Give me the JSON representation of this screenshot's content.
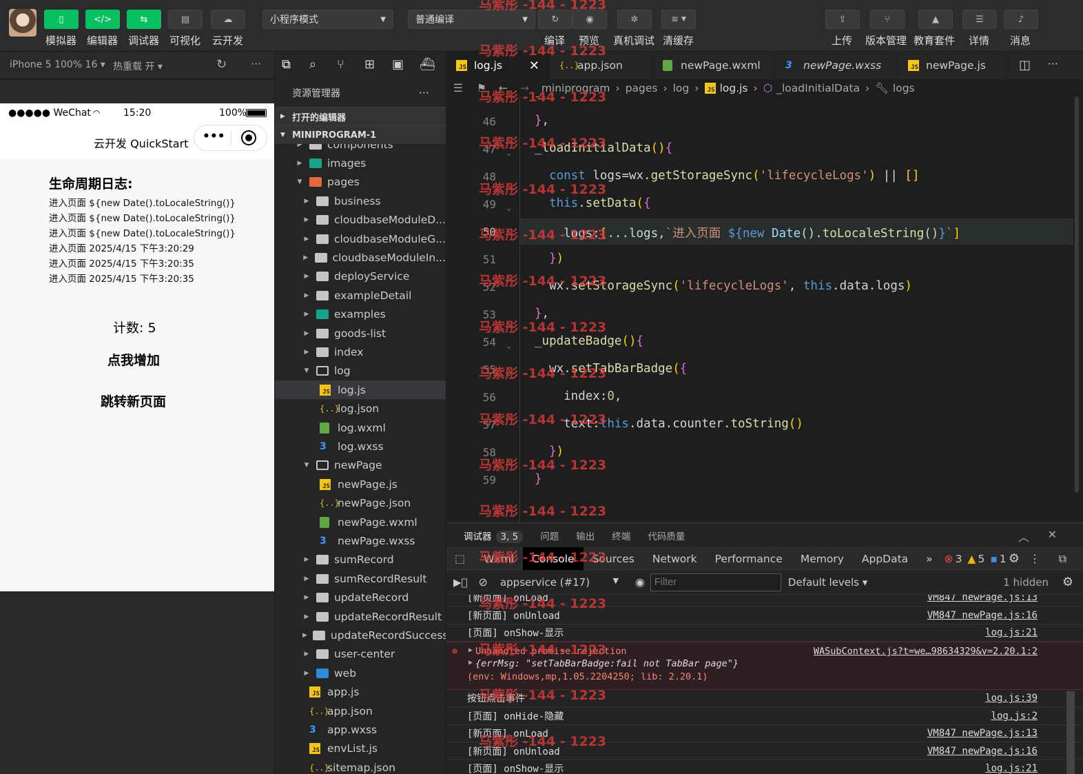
{
  "toolbar": {
    "left_buttons": [
      {
        "label": "模拟器",
        "icon": "phone-icon",
        "glyph": "▯"
      },
      {
        "label": "编辑器",
        "icon": "code-icon",
        "glyph": "</>"
      },
      {
        "label": "调试器",
        "icon": "debug-icon",
        "glyph": "⇆"
      },
      {
        "label": "可视化",
        "icon": "layout-icon",
        "glyph": "▤"
      },
      {
        "label": "云开发",
        "icon": "cloud-icon",
        "glyph": "☁"
      }
    ],
    "mode_select": "小程序模式",
    "compile_select": "普通编译",
    "mid_buttons": [
      {
        "label": "编译",
        "icon": "refresh-icon",
        "glyph": "↻"
      },
      {
        "label": "预览",
        "icon": "eye-icon",
        "glyph": "◉"
      },
      {
        "label": "真机调试",
        "icon": "bug-icon",
        "glyph": "✲"
      },
      {
        "label": "清缓存",
        "icon": "layers-icon",
        "glyph": "≋"
      }
    ],
    "right_buttons": [
      {
        "label": "上传",
        "icon": "upload-icon",
        "glyph": "⇪"
      },
      {
        "label": "版本管理",
        "icon": "branch-icon",
        "glyph": "⑂"
      },
      {
        "label": "教育套件",
        "icon": "graduation-icon",
        "glyph": "▲"
      },
      {
        "label": "详情",
        "icon": "menu-icon",
        "glyph": "☰"
      },
      {
        "label": "消息",
        "icon": "bell-icon",
        "glyph": "♪"
      }
    ]
  },
  "simulator": {
    "device": "iPhone 5 100% 16 ▾",
    "hot_reload": "热重载 开 ▾",
    "status_carrier": "●●●●● WeChat",
    "status_time": "15:20",
    "status_battery": "100%",
    "nav_title": "云开发 QuickStart",
    "log_title": "生命周期日志:",
    "logs": [
      "进入页面 ${new Date().toLocaleString()}",
      "进入页面 ${new Date().toLocaleString()}",
      "进入页面 ${new Date().toLocaleString()}",
      "进入页面 2025/4/15 下午3:20:29",
      "进入页面 2025/4/15 下午3:20:35",
      "进入页面 2025/4/15 下午3:20:35"
    ],
    "counter_label": "计数: 5",
    "increment_button": "点我增加",
    "navigate_button": "跳转新页面"
  },
  "explorer": {
    "title": "资源管理器",
    "open_editors": "打开的编辑器",
    "project": "MINIPROGRAM-1",
    "items": [
      {
        "name": "components",
        "kind": "folder",
        "depth": 1
      },
      {
        "name": "images",
        "kind": "img-folder",
        "depth": 1
      },
      {
        "name": "pages",
        "kind": "pages-folder",
        "depth": 1,
        "open": true
      },
      {
        "name": "business",
        "kind": "folder",
        "depth": 2
      },
      {
        "name": "cloudbaseModuleD...",
        "kind": "folder",
        "depth": 2
      },
      {
        "name": "cloudbaseModuleG...",
        "kind": "folder",
        "depth": 2
      },
      {
        "name": "cloudbaseModuleIn...",
        "kind": "folder",
        "depth": 2
      },
      {
        "name": "deployService",
        "kind": "folder",
        "depth": 2
      },
      {
        "name": "exampleDetail",
        "kind": "folder",
        "depth": 2
      },
      {
        "name": "examples",
        "kind": "img-folder",
        "depth": 2
      },
      {
        "name": "goods-list",
        "kind": "folder",
        "depth": 2
      },
      {
        "name": "index",
        "kind": "folder",
        "depth": 2
      },
      {
        "name": "log",
        "kind": "folder-open",
        "depth": 2,
        "open": true
      },
      {
        "name": "log.js",
        "kind": "js",
        "depth": 3,
        "selected": true
      },
      {
        "name": "log.json",
        "kind": "json",
        "depth": 3
      },
      {
        "name": "log.wxml",
        "kind": "wxml",
        "depth": 3
      },
      {
        "name": "log.wxss",
        "kind": "wxss",
        "depth": 3
      },
      {
        "name": "newPage",
        "kind": "folder-open",
        "depth": 2,
        "open": true
      },
      {
        "name": "newPage.js",
        "kind": "js",
        "depth": 3
      },
      {
        "name": "newPage.json",
        "kind": "json",
        "depth": 3
      },
      {
        "name": "newPage.wxml",
        "kind": "wxml",
        "depth": 3
      },
      {
        "name": "newPage.wxss",
        "kind": "wxss",
        "depth": 3
      },
      {
        "name": "sumRecord",
        "kind": "folder",
        "depth": 2
      },
      {
        "name": "sumRecordResult",
        "kind": "folder",
        "depth": 2
      },
      {
        "name": "updateRecord",
        "kind": "folder",
        "depth": 2
      },
      {
        "name": "updateRecordResult",
        "kind": "folder",
        "depth": 2
      },
      {
        "name": "updateRecordSuccess",
        "kind": "folder",
        "depth": 2
      },
      {
        "name": "user-center",
        "kind": "folder",
        "depth": 2
      },
      {
        "name": "web",
        "kind": "web-folder",
        "depth": 2
      },
      {
        "name": "app.js",
        "kind": "js",
        "depth": 1
      },
      {
        "name": "app.json",
        "kind": "json",
        "depth": 1
      },
      {
        "name": "app.wxss",
        "kind": "wxss",
        "depth": 1
      },
      {
        "name": "envList.js",
        "kind": "js",
        "depth": 1
      },
      {
        "name": "sitemap.json",
        "kind": "json",
        "depth": 1
      }
    ]
  },
  "editor": {
    "tabs": [
      {
        "name": "log.js",
        "icon": "js",
        "active": true
      },
      {
        "name": "app.json",
        "icon": "json"
      },
      {
        "name": "newPage.wxml",
        "icon": "wxml"
      },
      {
        "name": "newPage.wxss",
        "icon": "wxss"
      },
      {
        "name": "newPage.js",
        "icon": "js"
      }
    ],
    "breadcrumb": [
      "miniprogram",
      "pages",
      "log",
      "log.js",
      "_loadInitialData",
      "logs"
    ],
    "current_line": "50",
    "lines": [
      {
        "n": "46",
        "t": "},"
      },
      {
        "n": "47",
        "t": "_loadInitialData(){"
      },
      {
        "n": "48",
        "t": "  const logs=wx.getStorageSync('lifecycleLogs') || []"
      },
      {
        "n": "49",
        "t": "  this.setData({"
      },
      {
        "n": "50",
        "t": "    logs:[...logs,`进入页面 ${new Date().toLocaleString()}`]"
      },
      {
        "n": "51",
        "t": "  })"
      },
      {
        "n": "52",
        "t": "  wx.setStorageSync('lifecycleLogs', this.data.logs)"
      },
      {
        "n": "53",
        "t": "},"
      },
      {
        "n": "54",
        "t": "_updateBadge(){"
      },
      {
        "n": "55",
        "t": "  wx.setTabBarBadge({"
      },
      {
        "n": "56",
        "t": "    index:0,"
      },
      {
        "n": "57",
        "t": "    text:this.data.counter.toString()"
      },
      {
        "n": "58",
        "t": "  })"
      },
      {
        "n": "59",
        "t": "}"
      }
    ],
    "watermark": "马紫彤 -144 - 1223"
  },
  "panel": {
    "tabs": [
      {
        "label": "调试器",
        "badge": "3, 5",
        "active": true
      },
      {
        "label": "问题"
      },
      {
        "label": "输出"
      },
      {
        "label": "终端"
      },
      {
        "label": "代码质量"
      }
    ],
    "devtools_tabs": [
      "Wxml",
      "Console",
      "Sources",
      "Network",
      "Performance",
      "Memory",
      "AppData"
    ],
    "active_devtools_tab": "Console",
    "more_tabs": "»",
    "error_count": "3",
    "warn_count": "5",
    "info_count": "1",
    "context": "appservice (#17)",
    "filter_placeholder": "Filter",
    "levels": "Default levels ▾",
    "hidden": "1 hidden",
    "console_rows_top": [
      {
        "text": "[新页面] onLoad",
        "src": "VM847 newPage.js:13"
      },
      {
        "text": "[新页面] onUnload",
        "src": "VM847 newPage.js:16"
      },
      {
        "text": "[页面] onShow-显示",
        "src": "log.js:21"
      }
    ],
    "error": {
      "title": "Unhandled promise rejection",
      "src": "WASubContext.js?t=we…98634329&v=2.20.1:2",
      "detail": "{errMsg: \"setTabBarBadge:fail not TabBar page\"}",
      "env": "(env: Windows,mp,1.05.2204250; lib: 2.20.1)"
    },
    "console_rows_bottom": [
      {
        "text": "按钮点击事件",
        "src": "log.js:39"
      },
      {
        "text": "[页面] onHide-隐藏",
        "src": "log.js:2"
      },
      {
        "text": "[新页面] onLoad",
        "src": "VM847 newPage.js:13"
      },
      {
        "text": "[新页面] onUnload",
        "src": "VM847 newPage.js:16"
      },
      {
        "text": "[页面] onShow-显示",
        "src": "log.js:21"
      }
    ]
  }
}
